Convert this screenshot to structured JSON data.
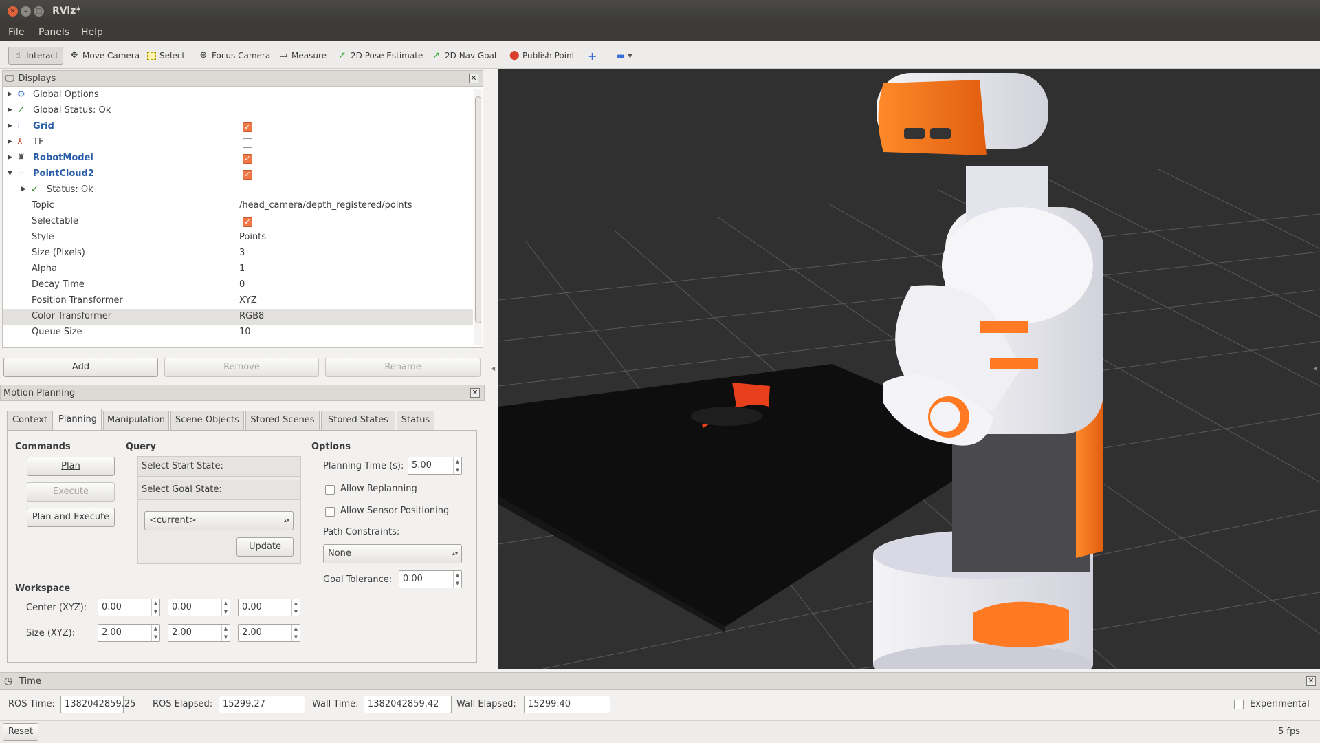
{
  "window": {
    "title": "RViz*"
  },
  "menu": {
    "items": [
      "File",
      "Panels",
      "Help"
    ]
  },
  "toolbar": {
    "tools": [
      {
        "label": "Interact",
        "icon": "hand-icon",
        "active": true
      },
      {
        "label": "Move Camera",
        "icon": "move-camera-icon"
      },
      {
        "label": "Select",
        "icon": "select-icon"
      },
      {
        "label": "Focus Camera",
        "icon": "focus-camera-icon"
      },
      {
        "label": "Measure",
        "icon": "ruler-icon"
      },
      {
        "label": "2D Pose Estimate",
        "icon": "green-arrow-icon"
      },
      {
        "label": "2D Nav Goal",
        "icon": "green-arrow-icon"
      },
      {
        "label": "Publish Point",
        "icon": "map-pin-icon"
      }
    ]
  },
  "displays": {
    "title": "Displays",
    "rows": [
      {
        "label": "Global Options",
        "value": ""
      },
      {
        "label": "Global Status: Ok",
        "value": ""
      },
      {
        "label": "Grid",
        "value": ""
      },
      {
        "label": "TF",
        "value": ""
      },
      {
        "label": "RobotModel",
        "value": ""
      },
      {
        "label": "PointCloud2",
        "value": ""
      },
      {
        "label": "Status: Ok",
        "value": ""
      },
      {
        "label": "Topic",
        "value": "/head_camera/depth_registered/points"
      },
      {
        "label": "Selectable",
        "value": ""
      },
      {
        "label": "Style",
        "value": "Points"
      },
      {
        "label": "Size (Pixels)",
        "value": "3"
      },
      {
        "label": "Alpha",
        "value": "1"
      },
      {
        "label": "Decay Time",
        "value": "0"
      },
      {
        "label": "Position Transformer",
        "value": "XYZ"
      },
      {
        "label": "Color Transformer",
        "value": "RGB8"
      },
      {
        "label": "Queue Size",
        "value": "10"
      }
    ],
    "checked": {
      "Grid": true,
      "TF": false,
      "RobotModel": true,
      "PointCloud2": true,
      "Selectable": true
    },
    "buttons": {
      "add": "Add",
      "remove": "Remove",
      "rename": "Rename"
    }
  },
  "motion": {
    "title": "Motion Planning",
    "tabs": [
      "Context",
      "Planning",
      "Manipulation",
      "Scene Objects",
      "Stored Scenes",
      "Stored States",
      "Status"
    ],
    "commands": {
      "title": "Commands",
      "plan": "Plan",
      "execute": "Execute",
      "plan_execute": "Plan and Execute"
    },
    "query": {
      "title": "Query",
      "start": "Select Start State:",
      "goal": "Select Goal State:",
      "current": "<current>",
      "update": "Update"
    },
    "options": {
      "title": "Options",
      "planning_time_label": "Planning Time (s):",
      "planning_time": "5.00",
      "allow_replanning": "Allow Replanning",
      "allow_sensor": "Allow Sensor Positioning",
      "path_constraints_label": "Path Constraints:",
      "path_constraints": "None",
      "goal_tolerance_label": "Goal Tolerance:",
      "goal_tolerance": "0.00"
    },
    "workspace": {
      "title": "Workspace",
      "center_label": "Center (XYZ):",
      "size_label": "Size (XYZ):",
      "center": [
        "0.00",
        "0.00",
        "0.00"
      ],
      "size": [
        "2.00",
        "2.00",
        "2.00"
      ]
    }
  },
  "time": {
    "title": "Time",
    "ros_time_label": "ROS Time:",
    "ros_time": "1382042859.25",
    "ros_elapsed_label": "ROS Elapsed:",
    "ros_elapsed": "15299.27",
    "wall_time_label": "Wall Time:",
    "wall_time": "1382042859.42",
    "wall_elapsed_label": "Wall Elapsed:",
    "wall_elapsed": "15299.40",
    "experimental": "Experimental"
  },
  "status": {
    "reset": "Reset",
    "fps": "5 fps"
  },
  "colors": {
    "accent_orange": "#f07746",
    "link_blue": "#2a5ea8",
    "viewport_bg": "#303030"
  }
}
